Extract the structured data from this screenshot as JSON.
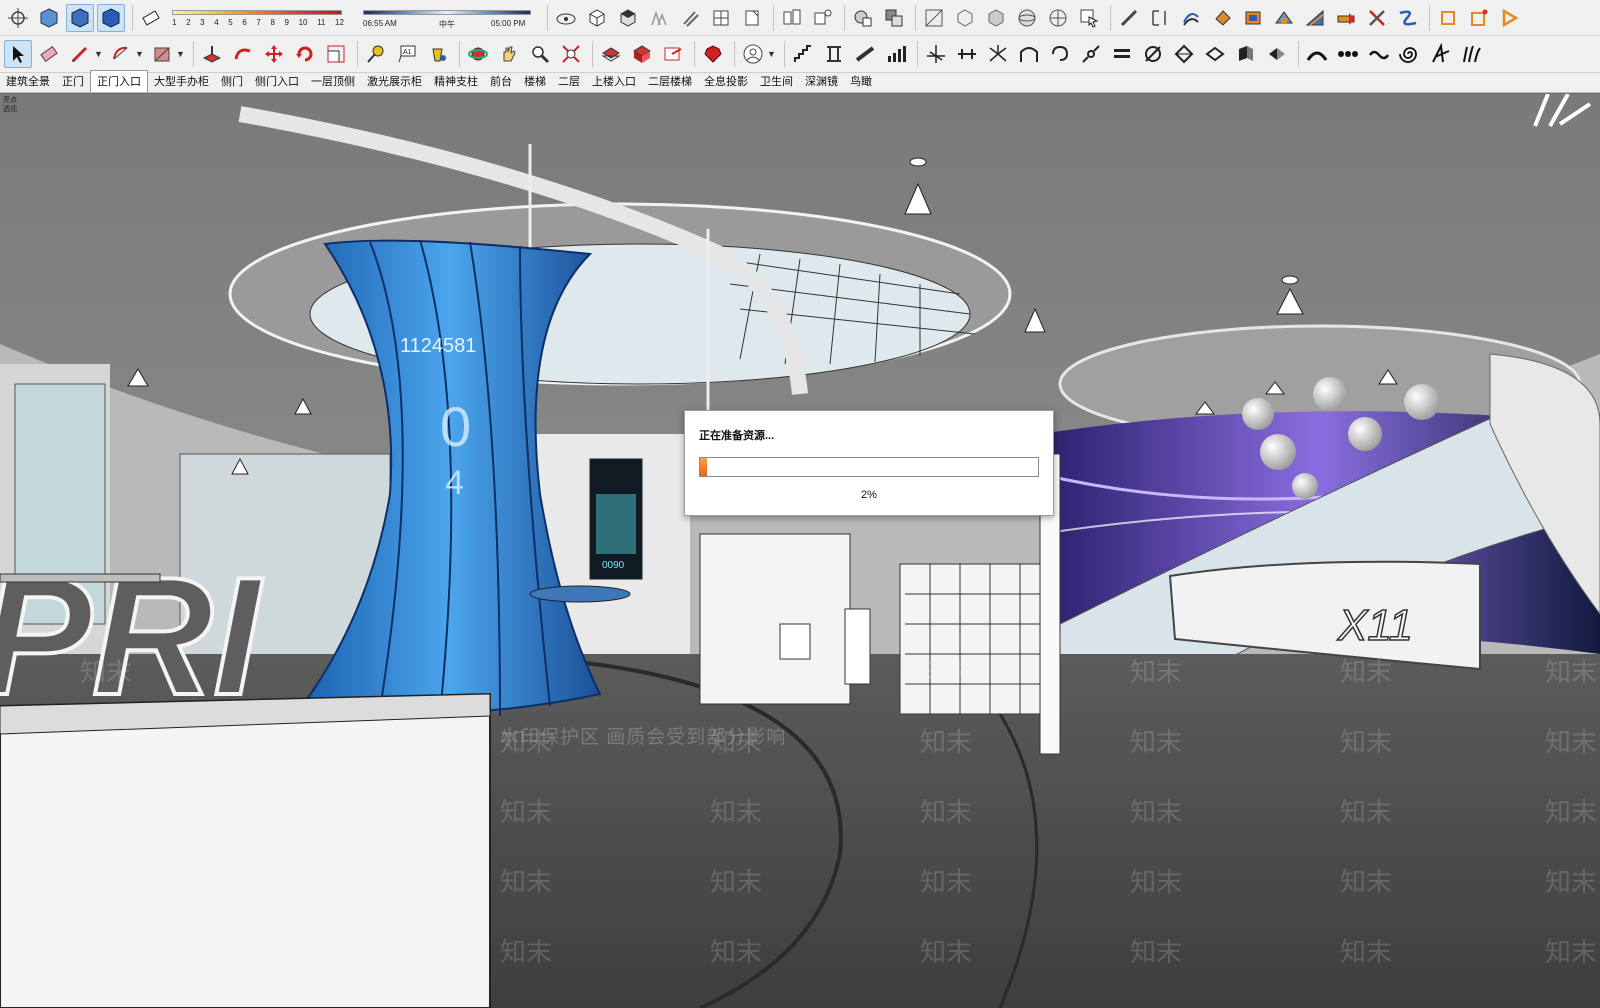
{
  "toolbar": {
    "shadow_months": [
      "1",
      "2",
      "3",
      "4",
      "5",
      "6",
      "7",
      "8",
      "9",
      "10",
      "11",
      "12"
    ],
    "time_start": "06:55 AM",
    "time_mid": "中午",
    "time_end": "05:00 PM"
  },
  "tabs": [
    {
      "label": "建筑全景"
    },
    {
      "label": "正门"
    },
    {
      "label": "正门入口"
    },
    {
      "label": "大型手办柜"
    },
    {
      "label": "侧门"
    },
    {
      "label": "侧门入口"
    },
    {
      "label": "一层顶侧"
    },
    {
      "label": "激光展示柜"
    },
    {
      "label": "精神支柱"
    },
    {
      "label": "前台"
    },
    {
      "label": "楼梯"
    },
    {
      "label": "二层"
    },
    {
      "label": "上楼入口"
    },
    {
      "label": "二层楼梯"
    },
    {
      "label": "全息投影"
    },
    {
      "label": "卫生间"
    },
    {
      "label": "深渊镜"
    },
    {
      "label": "鸟瞰"
    }
  ],
  "active_tab": "正门入口",
  "viewport": {
    "camera_line1": "亮点",
    "camera_line2": "透视",
    "column_numbers": [
      "1124581",
      "0",
      "4"
    ],
    "reception_text": "PRI",
    "counter_text": "X11",
    "poster_text": "0090"
  },
  "dialog": {
    "message": "正在准备资源...",
    "progress": 0.02,
    "percent_text": "2%"
  },
  "watermark": {
    "text": "知末",
    "banner": "水印保护区  画质会受到部分影响"
  },
  "colors": {
    "accent": "#e8661a",
    "toolbar_bg": "#f0f0f0",
    "screen_blue": "#2f8fd8"
  }
}
